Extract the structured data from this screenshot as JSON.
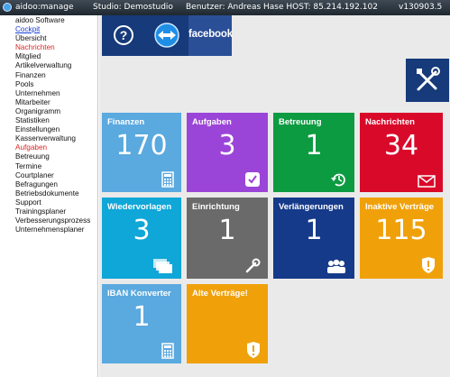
{
  "window": {
    "app_title": "aidoo:manage",
    "studio": "Studio: Demostudio",
    "user_host": "Benutzer: Andreas Hase HOST: 85.214.192.102",
    "version": "v130903.5"
  },
  "sidebar": {
    "items": [
      {
        "label": "aidoo Software",
        "style": "normal"
      },
      {
        "label": "Cockpit",
        "style": "link"
      },
      {
        "label": "Übersicht",
        "style": "normal"
      },
      {
        "label": "Nachrichten",
        "style": "red"
      },
      {
        "label": "Mitglied",
        "style": "normal"
      },
      {
        "label": "Artikelverwaltung",
        "style": "normal"
      },
      {
        "label": "Finanzen",
        "style": "normal"
      },
      {
        "label": "Pools",
        "style": "normal"
      },
      {
        "label": "Unternehmen",
        "style": "normal"
      },
      {
        "label": "Mitarbeiter",
        "style": "normal"
      },
      {
        "label": "Organigramm",
        "style": "normal"
      },
      {
        "label": "Statistiken",
        "style": "normal"
      },
      {
        "label": "Einstellungen",
        "style": "normal"
      },
      {
        "label": "Kassenverwaltung",
        "style": "normal"
      },
      {
        "label": "Aufgaben",
        "style": "red"
      },
      {
        "label": "Betreuung",
        "style": "normal"
      },
      {
        "label": "Termine",
        "style": "normal"
      },
      {
        "label": "Courtplaner",
        "style": "normal"
      },
      {
        "label": "Befragungen",
        "style": "normal"
      },
      {
        "label": "Betriebsdokumente",
        "style": "normal"
      },
      {
        "label": "Support",
        "style": "normal"
      },
      {
        "label": "Trainingsplaner",
        "style": "normal"
      },
      {
        "label": "Verbesserungsprozess",
        "style": "normal"
      },
      {
        "label": "Unternehmensplaner",
        "style": "normal"
      }
    ]
  },
  "toolbar": {
    "help_icon": "help-icon",
    "teamviewer_icon": "teamviewer-icon",
    "facebook_label": "facebook",
    "tools_icon": "tools-icon"
  },
  "tiles": {
    "finanzen": {
      "label": "Finanzen",
      "value": "170",
      "icon": "calculator-icon",
      "color": "#5aa9df"
    },
    "aufgaben": {
      "label": "Aufgaben",
      "value": "3",
      "icon": "checkbox-icon",
      "color": "#9b45d8"
    },
    "betreuung": {
      "label": "Betreuung",
      "value": "1",
      "icon": "history-icon",
      "color": "#0d9b41"
    },
    "nachrichten": {
      "label": "Nachrichten",
      "value": "34",
      "icon": "mail-icon",
      "color": "#d9092a"
    },
    "wiedervorlagen": {
      "label": "Wiedervorlagen",
      "value": "3",
      "icon": "cards-icon",
      "color": "#0fa6d8"
    },
    "einrichtung": {
      "label": "Einrichtung",
      "value": "1",
      "icon": "wrench-icon",
      "color": "#6a6a6a"
    },
    "verlaengerungen": {
      "label": "Verlängerungen",
      "value": "1",
      "icon": "group-icon",
      "color": "#163a8a"
    },
    "inaktive": {
      "label": "Inaktive Verträge",
      "value": "115",
      "icon": "warning-shield-icon",
      "color": "#f0a10a"
    },
    "iban": {
      "label": "IBAN Konverter",
      "value": "1",
      "icon": "calculator-icon",
      "color": "#5aa9df"
    },
    "alte": {
      "label": "Alte Verträge!",
      "value": "",
      "icon": "warning-shield-icon",
      "color": "#f0a10a"
    }
  }
}
